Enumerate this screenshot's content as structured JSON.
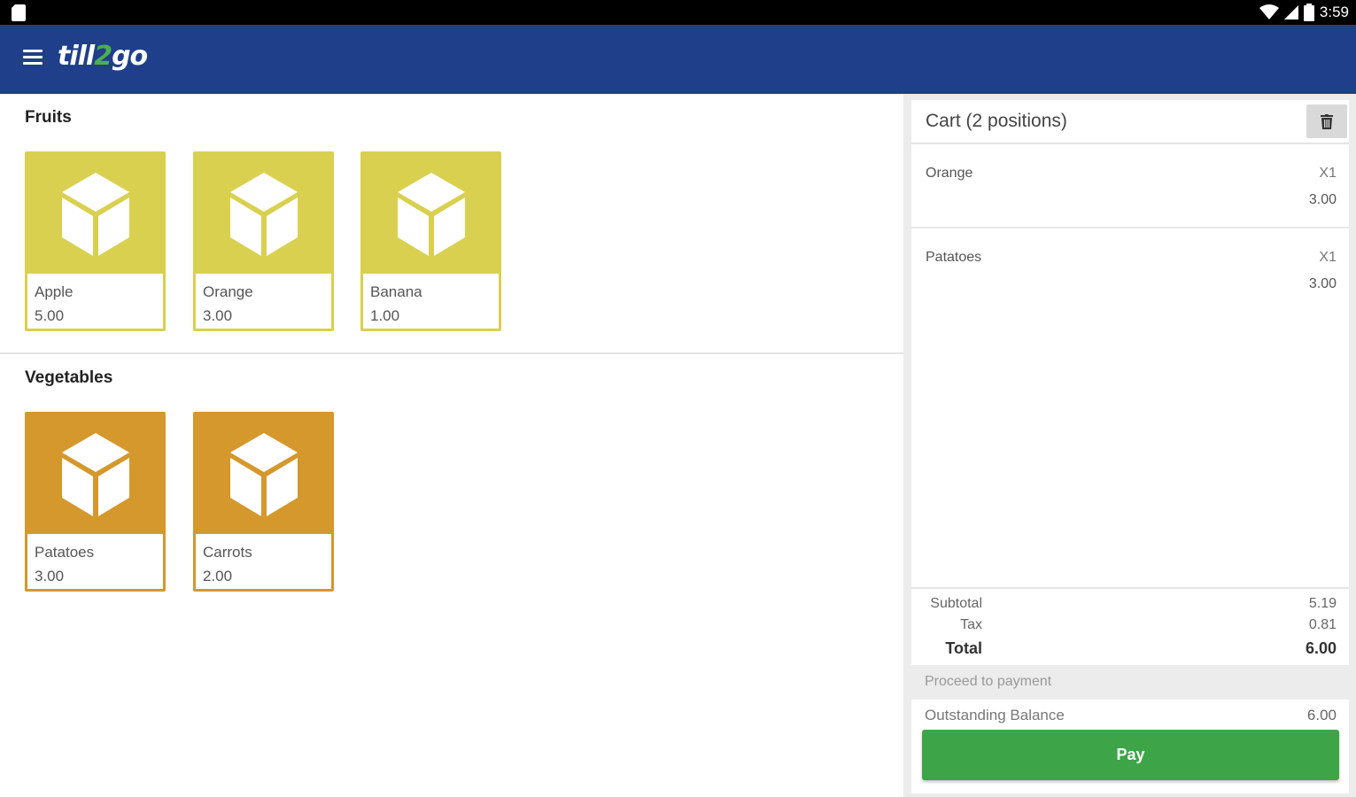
{
  "status_bar": {
    "time": "3:59"
  },
  "app_bar": {
    "logo_part1": "till",
    "logo_part2": "2",
    "logo_part3": "go"
  },
  "catalog": {
    "sections": [
      {
        "title": "Fruits",
        "products": [
          {
            "name": "Apple",
            "price": "5.00"
          },
          {
            "name": "Orange",
            "price": "3.00"
          },
          {
            "name": "Banana",
            "price": "1.00"
          }
        ]
      },
      {
        "title": "Vegetables",
        "products": [
          {
            "name": "Patatoes",
            "price": "3.00"
          },
          {
            "name": "Carrots",
            "price": "2.00"
          }
        ]
      }
    ]
  },
  "cart": {
    "title": "Cart (2 positions)",
    "items": [
      {
        "name": "Orange",
        "qty": "X1",
        "price": "3.00"
      },
      {
        "name": "Patatoes",
        "qty": "X1",
        "price": "3.00"
      }
    ],
    "subtotal_label": "Subtotal",
    "subtotal": "5.19",
    "tax_label": "Tax",
    "tax": "0.81",
    "total_label": "Total",
    "total": "6.00"
  },
  "payment": {
    "proceed_label": "Proceed to payment",
    "outstanding_label": "Outstanding Balance",
    "outstanding_value": "6.00",
    "pay_label": "Pay"
  },
  "colors": {
    "app_bar": "#1f3f8a",
    "fruit_tile": "#d9d050",
    "veg_tile": "#d4982c",
    "pay_button": "#3da547"
  },
  "icons": [
    "menu-icon",
    "trash-icon",
    "product-cube-icon",
    "wifi-icon",
    "signal-icon",
    "battery-icon",
    "sd-card-icon"
  ]
}
